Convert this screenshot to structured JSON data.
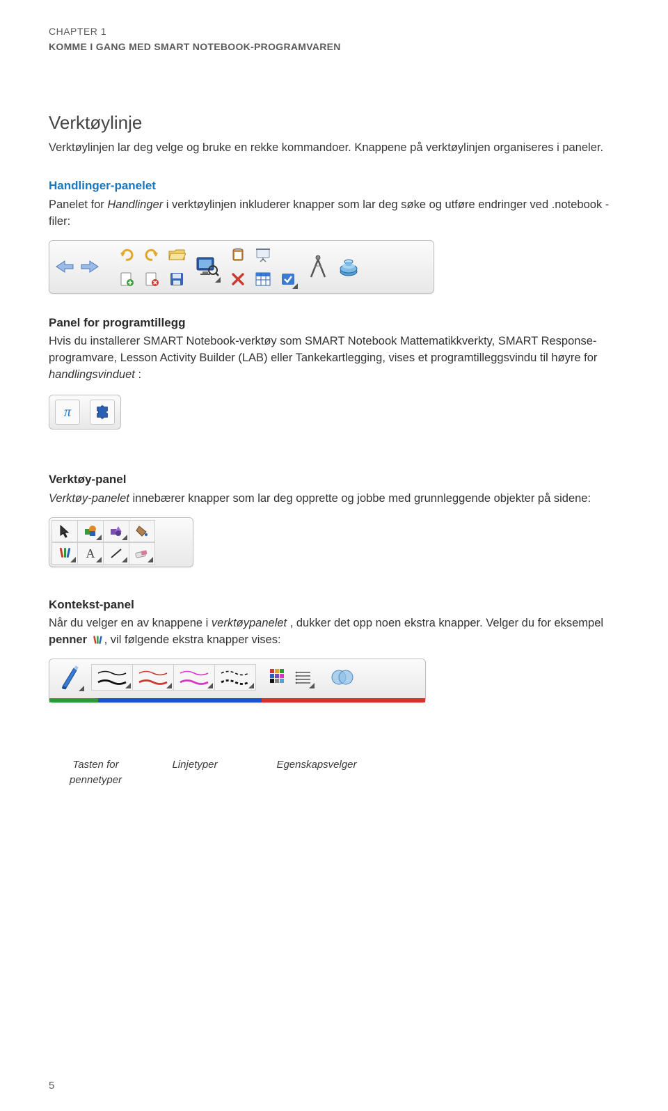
{
  "header": {
    "chapter_label": "CHAPTER 1",
    "chapter_title": "KOMME I GANG MED SMART NOTEBOOK-PROGRAMVAREN"
  },
  "section": {
    "title": "Verktøylinje",
    "intro": "Verktøylinjen lar deg velge og bruke en rekke kommandoer. Knappene på verktøylinjen organiseres i paneler."
  },
  "handlinger": {
    "heading": "Handlinger-panelet",
    "text_pre": "Panelet for ",
    "text_em": "Handlinger",
    "text_post": " i verktøylinjen inkluderer knapper som lar deg søke og utføre endringer ved .notebook -filer:"
  },
  "programtillegg": {
    "heading": "Panel for programtillegg",
    "text": "Hvis du installerer SMART Notebook-verktøy som SMART Notebook Mattematikkverkty, SMART Response-programvare, Lesson Activity Builder (LAB) eller Tankekartlegging, vises et programtilleggsvindu til høyre for ",
    "text_em": "handlingsvinduet",
    "text_post2": " :"
  },
  "verktoy_panel": {
    "heading": "Verktøy-panel",
    "text_em": "Verktøy-panelet",
    "text_post": " innebærer knapper som lar deg opprette og jobbe med grunnleggende objekter på sidene:"
  },
  "kontekst_panel": {
    "heading": "Kontekst-panel",
    "text_pre": "Når du velger en av knappene i ",
    "text_em": "verktøypanelet",
    "text_mid": " , dukker det opp noen ekstra knapper. Velger du for eksempel ",
    "text_bold": "penner",
    "text_post": ", vil følgende ekstra knapper vises:"
  },
  "annotations": {
    "a1_line1": "Tasten for",
    "a1_line2": "pennetyper",
    "a2": "Linjetyper",
    "a3": "Egenskapsvelger"
  },
  "icons": {
    "back": "back-arrow",
    "forward": "forward-arrow",
    "undo": "undo",
    "redo": "redo",
    "folder": "open-folder",
    "page_add": "page-add",
    "page_delete": "page-delete",
    "save": "save-disk",
    "monitor_zoom": "monitor-zoom",
    "clipboard": "clipboard",
    "delete_x": "delete-x",
    "presentation": "presentation-screen",
    "table": "table",
    "snap": "snap-tool",
    "compass": "compass",
    "inkwell": "inkwell",
    "pi": "pi-symbol",
    "puzzle": "puzzle-piece",
    "cursor": "cursor-arrow",
    "shapes1": "shapes-colored",
    "shapes2": "shapes-purple",
    "fill": "paint-bucket",
    "pens": "pens",
    "text_a": "text-A",
    "line": "line",
    "eraser": "eraser",
    "pen_blue": "pen-blue",
    "swatch": "color-swatch",
    "options": "line-options",
    "overlap": "overlap-circles"
  },
  "colors": {
    "accent_blue": "#1976c0",
    "stripe_green": "#2b9b3a",
    "stripe_blue": "#1a4fd0",
    "stripe_red": "#d0342c"
  },
  "page_number": "5"
}
